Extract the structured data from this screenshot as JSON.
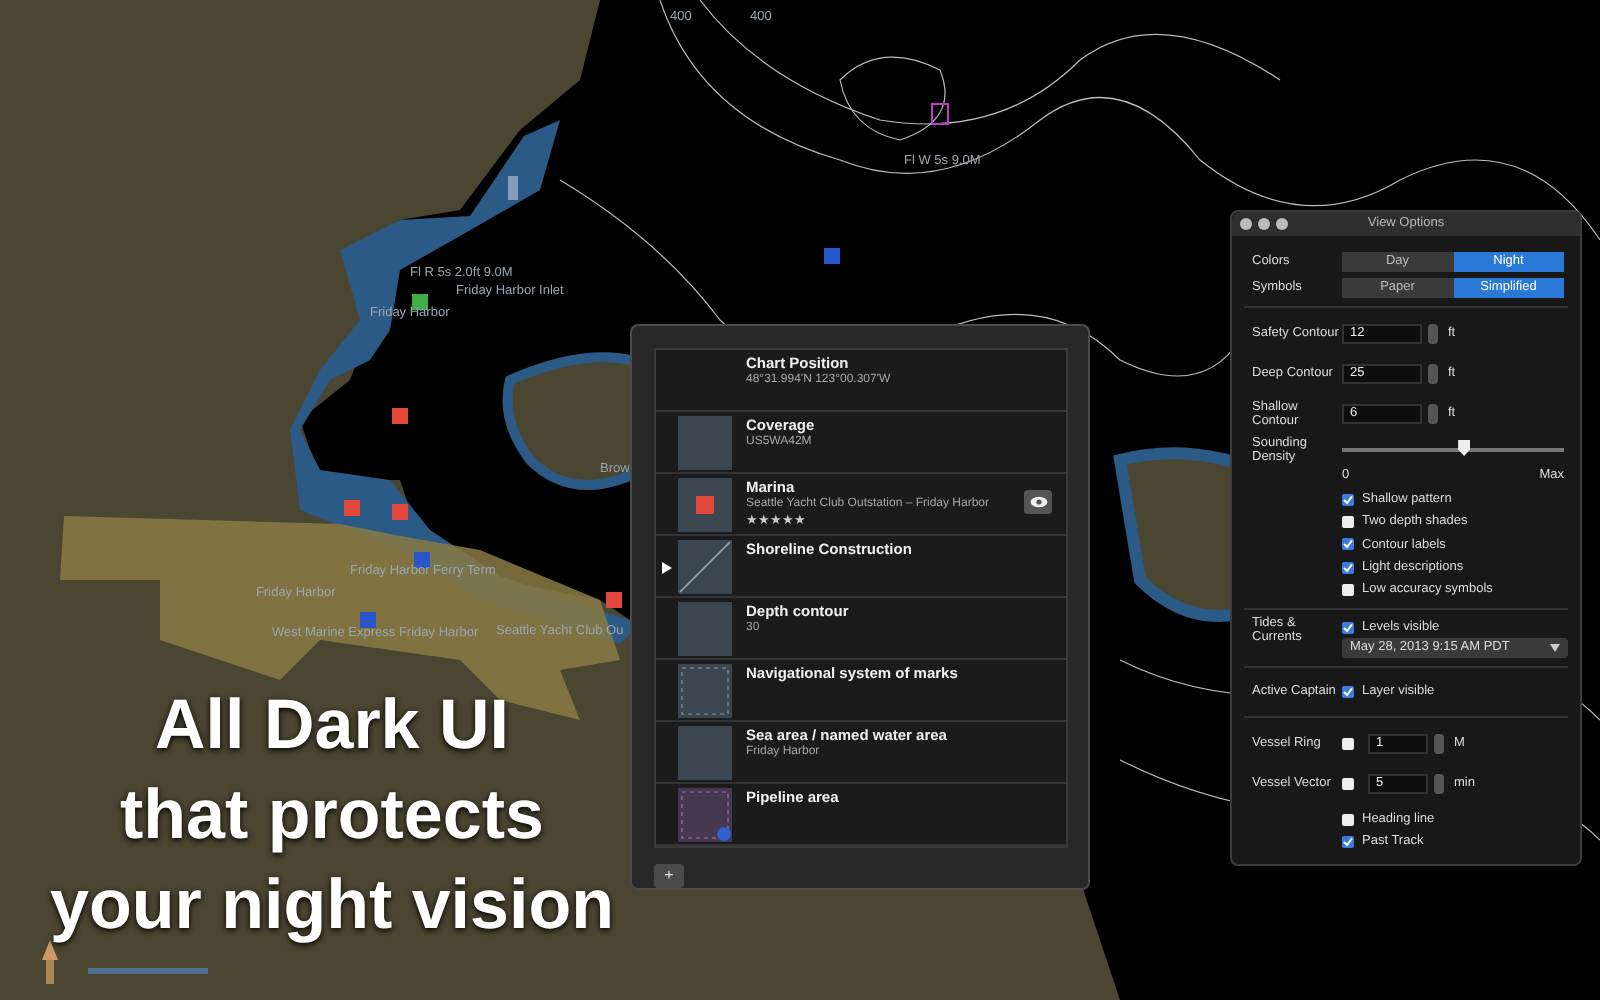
{
  "map": {
    "labels": [
      {
        "text": "400"
      },
      {
        "text": "400"
      },
      {
        "text": "Fl W 5s 9.0M"
      },
      {
        "text": "Fl R 5s 2.0ft 9.0M"
      },
      {
        "text": "Friday Harbor Inlet"
      },
      {
        "text": "Friday Harbor"
      },
      {
        "text": "Brow"
      },
      {
        "text": "Friday Harbor Ferry Term"
      },
      {
        "text": "Friday Harbor"
      },
      {
        "text": "West Marine Express Friday Harbor"
      },
      {
        "text": "Seattle Yacht Club Ou"
      }
    ]
  },
  "slogan": [
    "All Dark UI",
    "that protects",
    "your night vision"
  ],
  "feature_list": {
    "items": [
      {
        "title": "Chart Position",
        "subtitle": "48°31.994'N 123°00.307'W",
        "kind": "none",
        "selected": false,
        "eye_button": false
      },
      {
        "title": "Coverage",
        "subtitle": "US5WA42M",
        "kind": "plain",
        "selected": false,
        "eye_button": false
      },
      {
        "title": "Marina",
        "subtitle": "Seattle Yacht Club Outstation – Friday Harbor",
        "stars": 5,
        "kind": "marina",
        "selected": false,
        "eye_button": true
      },
      {
        "title": "Shoreline Construction",
        "kind": "line",
        "selected": true,
        "eye_button": false
      },
      {
        "title": "Depth contour",
        "subtitle": "30",
        "kind": "plain",
        "selected": false,
        "eye_button": false
      },
      {
        "title": "Navigational system of marks",
        "kind": "dashed",
        "selected": false,
        "eye_button": false
      },
      {
        "title": "Sea area / named water area",
        "subtitle": "Friday Harbor",
        "kind": "plain",
        "selected": false,
        "eye_button": false
      },
      {
        "title": "Pipeline area",
        "kind": "pipeline",
        "selected": false,
        "eye_button": false
      }
    ],
    "add_button": "+"
  },
  "view_options": {
    "title": "View Options",
    "segments": [
      {
        "label": "Colors",
        "options": [
          {
            "label": "Day",
            "selected": false
          },
          {
            "label": "Night",
            "selected": true
          }
        ]
      },
      {
        "label": "Symbols",
        "options": [
          {
            "label": "Paper",
            "selected": false
          },
          {
            "label": "Simplified",
            "selected": true
          }
        ]
      }
    ],
    "contours": [
      {
        "label": "Safety Contour",
        "value": "12",
        "unit": "ft"
      },
      {
        "label": "Deep Contour",
        "value": "25",
        "unit": "ft"
      },
      {
        "label": "Shallow Contour",
        "value": "6",
        "unit": "ft"
      }
    ],
    "density": {
      "label": "Sounding Density",
      "level": 0.55,
      "min_label": "0",
      "max_label": "Max"
    },
    "display_checks": [
      {
        "label": "Shallow pattern",
        "checked": true
      },
      {
        "label": "Two depth shades",
        "checked": false
      },
      {
        "label": "Contour labels",
        "checked": true
      },
      {
        "label": "Light descriptions",
        "checked": true
      },
      {
        "label": "Low accuracy symbols",
        "checked": false
      }
    ],
    "tides": {
      "label": "Tides & Currents",
      "check": {
        "label": "Levels visible",
        "checked": true
      },
      "date": "May 28, 2013 9:15 AM PDT"
    },
    "captain": {
      "label": "Active Captain",
      "check": {
        "label": "Layer visible",
        "checked": true
      }
    },
    "vessel": [
      {
        "label": "Vessel Ring",
        "checked": false,
        "value": "1",
        "unit": "M"
      },
      {
        "label": "Vessel Vector",
        "checked": false,
        "value": "5",
        "unit": "min"
      }
    ],
    "track_checks": [
      {
        "label": "Heading line",
        "checked": false
      },
      {
        "label": "Past Track",
        "checked": true
      }
    ]
  }
}
